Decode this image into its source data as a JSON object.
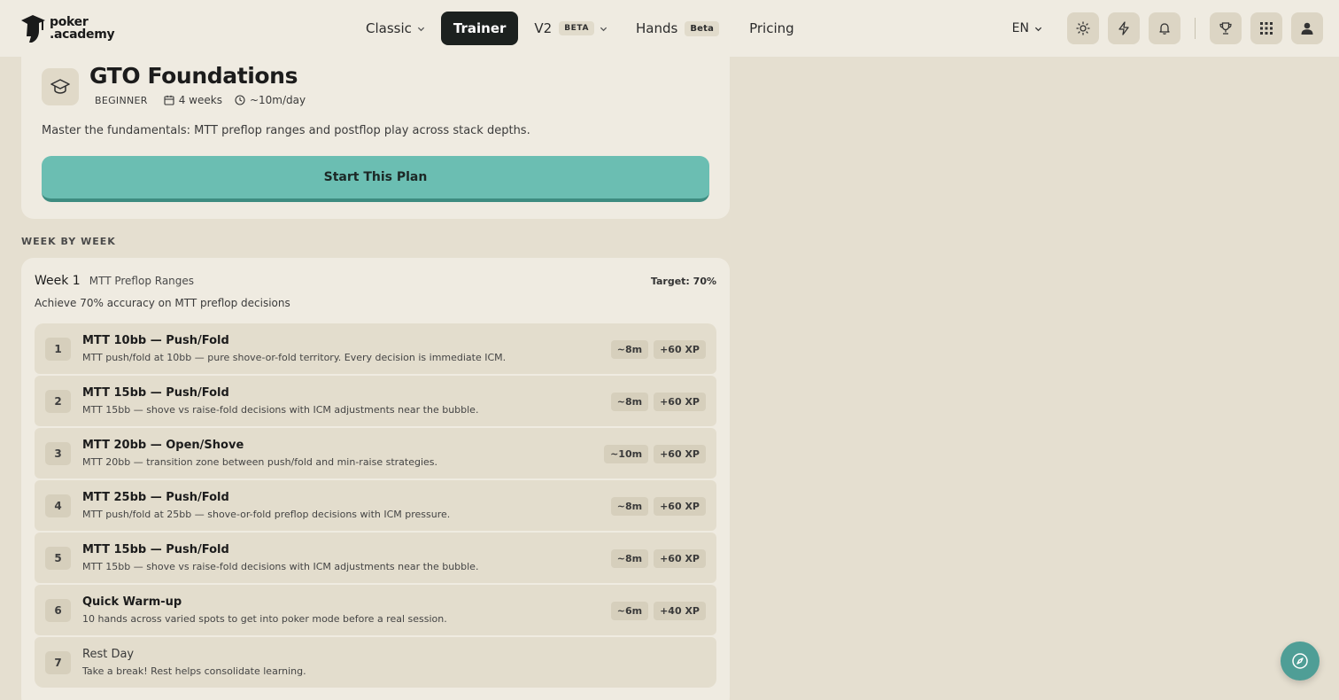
{
  "brand": {
    "line1": "poker",
    "line2": ".academy"
  },
  "nav": {
    "classic": "Classic",
    "trainer": "Trainer",
    "v2": "V2",
    "v2_badge": "BETA",
    "hands": "Hands",
    "hands_badge": "Beta",
    "pricing": "Pricing"
  },
  "tools": {
    "language": "EN"
  },
  "plan": {
    "title": "GTO Foundations",
    "level": "BEGINNER",
    "duration": "4 weeks",
    "daily": "~10m/day",
    "description": "Master the fundamentals: MTT preflop ranges and postflop play across stack depths.",
    "cta": "Start This Plan"
  },
  "section_label": "WEEK BY WEEK",
  "week": {
    "title": "Week 1",
    "subtitle": "MTT Preflop Ranges",
    "target": "Target: 70%",
    "description": "Achieve 70% accuracy on MTT preflop decisions",
    "lessons": [
      {
        "num": "1",
        "title": "MTT 10bb — Push/Fold",
        "desc": "MTT push/fold at 10bb — pure shove-or-fold territory. Every decision is immediate ICM.",
        "time": "~8m",
        "xp": "+60 XP"
      },
      {
        "num": "2",
        "title": "MTT 15bb — Push/Fold",
        "desc": "MTT 15bb — shove vs raise-fold decisions with ICM adjustments near the bubble.",
        "time": "~8m",
        "xp": "+60 XP"
      },
      {
        "num": "3",
        "title": "MTT 20bb — Open/Shove",
        "desc": "MTT 20bb — transition zone between push/fold and min-raise strategies.",
        "time": "~10m",
        "xp": "+60 XP"
      },
      {
        "num": "4",
        "title": "MTT 25bb — Push/Fold",
        "desc": "MTT push/fold at 25bb — shove-or-fold preflop decisions with ICM pressure.",
        "time": "~8m",
        "xp": "+60 XP"
      },
      {
        "num": "5",
        "title": "MTT 15bb — Push/Fold",
        "desc": "MTT 15bb — shove vs raise-fold decisions with ICM adjustments near the bubble.",
        "time": "~8m",
        "xp": "+60 XP"
      },
      {
        "num": "6",
        "title": "Quick Warm-up",
        "desc": "10 hands across varied spots to get into poker mode before a real session.",
        "time": "~6m",
        "xp": "+40 XP"
      },
      {
        "num": "7",
        "title": "Rest Day",
        "desc": "Take a break! Rest helps consolidate learning."
      }
    ]
  }
}
